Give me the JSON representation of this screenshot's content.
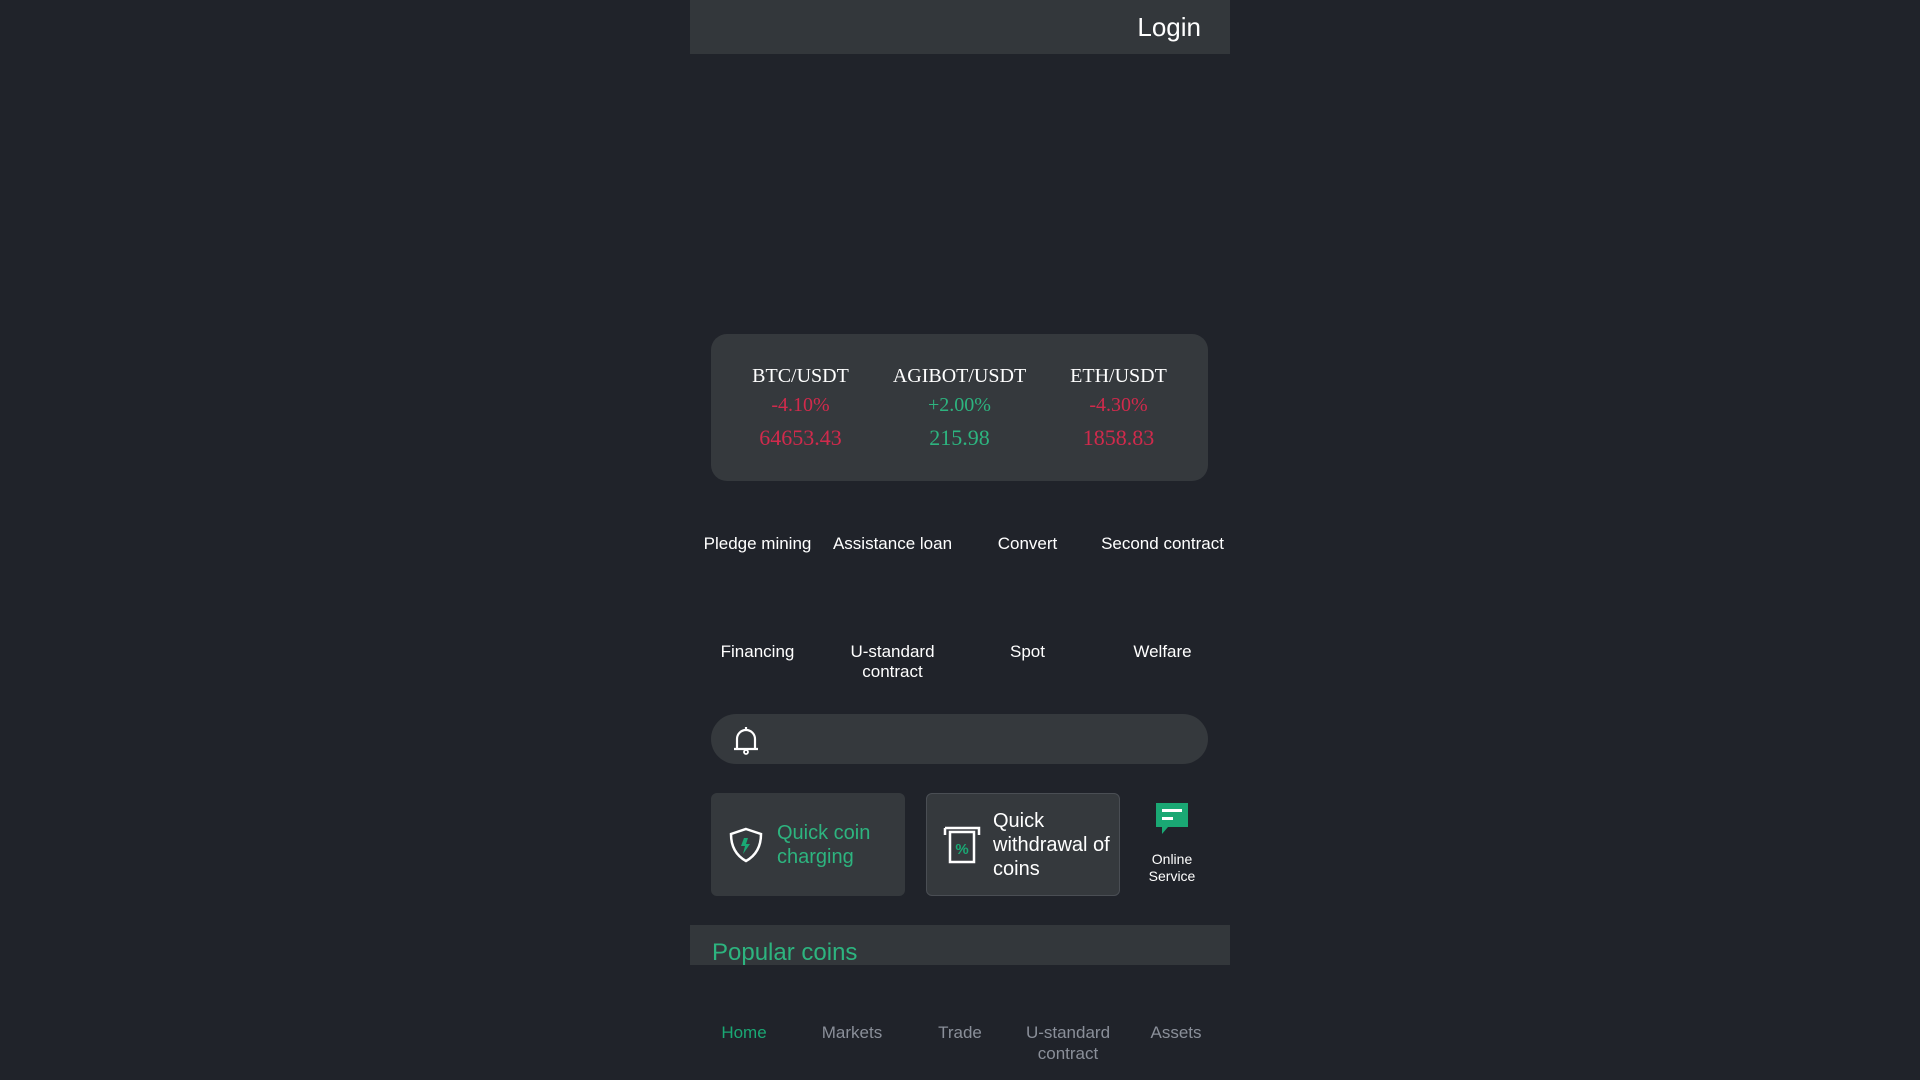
{
  "header": {
    "login_label": "Login"
  },
  "ticker": [
    {
      "pair": "BTC/USDT",
      "change": "-4.10%",
      "price": "64653.43",
      "trend": "down"
    },
    {
      "pair": "AGIBOT/USDT",
      "change": "+2.00%",
      "price": "215.98",
      "trend": "up"
    },
    {
      "pair": "ETH/USDT",
      "change": "-4.30%",
      "price": "1858.83",
      "trend": "down"
    }
  ],
  "menu": [
    "Pledge mining",
    "Assistance loan",
    "Convert",
    "Second contract",
    "Financing",
    "U-standard contract",
    "Spot",
    "Welfare"
  ],
  "actions": {
    "charge": "Quick coin charging",
    "withdraw": "Quick withdrawal of coins",
    "service": "Online Service"
  },
  "popular": {
    "title": "Popular coins"
  },
  "nav": [
    "Home",
    "Markets",
    "Trade",
    "U-standard contract",
    "Assets"
  ],
  "colors": {
    "up": "#2db47f",
    "down": "#d12a4c",
    "accent": "#1aa874"
  }
}
